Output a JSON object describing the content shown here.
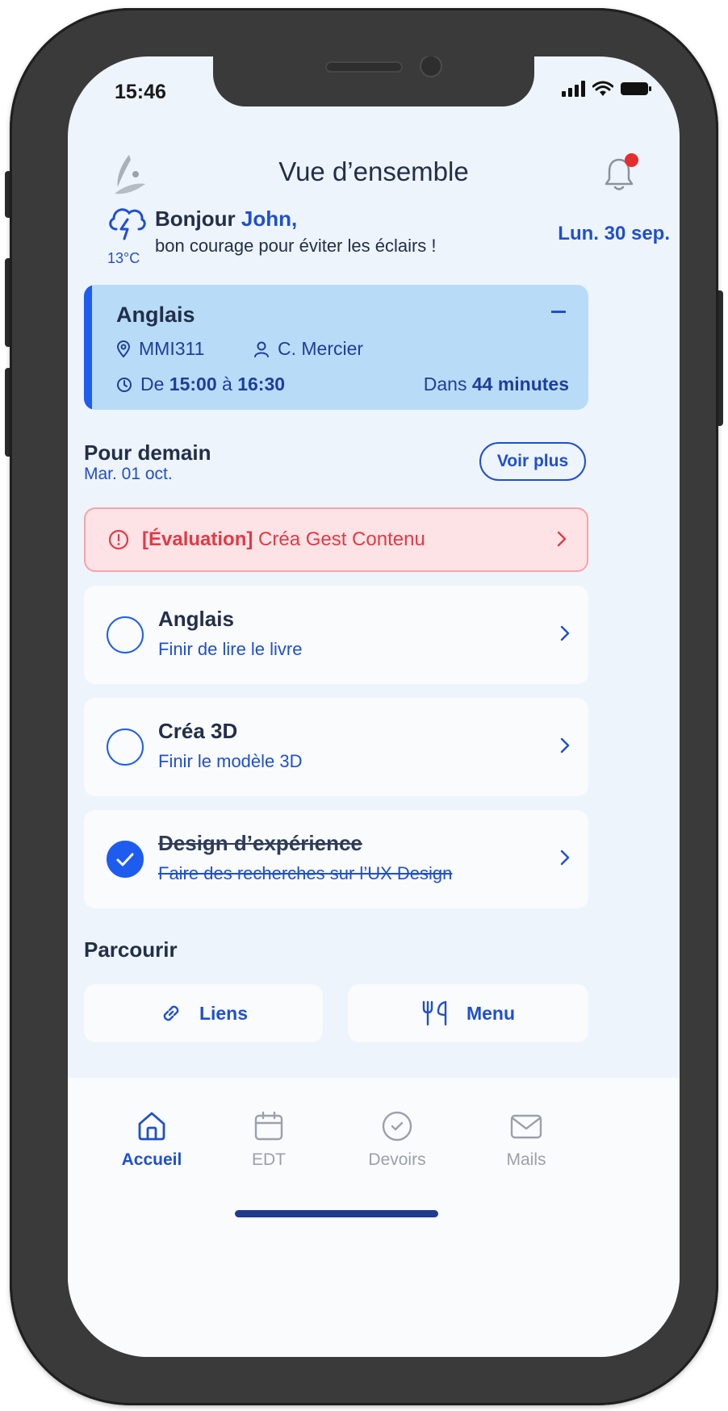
{
  "status_bar": {
    "time": "15:46"
  },
  "header": {
    "title": "Vue d’ensemble"
  },
  "greeting": {
    "hello": "Bonjour",
    "name": "John,",
    "message": "bon courage pour éviter les éclairs !",
    "temperature": "13°C",
    "date": "Lun. 30 sep."
  },
  "current_course": {
    "subject": "Anglais",
    "room": "MMI311",
    "teacher": "C. Mercier",
    "time_prefix": "De",
    "time_start": "15:00",
    "time_sep": "à",
    "time_end": "16:30",
    "countdown_prefix": "Dans",
    "countdown_value": "44 minutes"
  },
  "tomorrow": {
    "title": "Pour demain",
    "date": "Mar. 01 oct.",
    "see_more": "Voir plus",
    "alert": {
      "tag": "[Évaluation]",
      "text": "Créa Gest Contenu"
    },
    "tasks": [
      {
        "subject": "Anglais",
        "description": "Finir de lire le livre",
        "done": false
      },
      {
        "subject": "Créa 3D",
        "description": "Finir le modèle 3D",
        "done": false
      },
      {
        "subject": "Design d’expérience",
        "description": "Faire des recherches sur l’UX Design",
        "done": true
      }
    ]
  },
  "browse": {
    "title": "Parcourir",
    "links_label": "Liens",
    "menu_label": "Menu"
  },
  "bottom_nav": {
    "items": [
      {
        "label": "Accueil",
        "icon": "home-icon",
        "active": true
      },
      {
        "label": "EDT",
        "icon": "calendar-icon",
        "active": false
      },
      {
        "label": "Devoirs",
        "icon": "check-circle-icon",
        "active": false
      },
      {
        "label": "Mails",
        "icon": "mail-icon",
        "active": false
      }
    ]
  },
  "colors": {
    "accent": "#1e4fcf",
    "background": "#eef4fb",
    "course_card": "#b8dcf8",
    "alert": "#e53844",
    "notification_dot": "#e52d2d"
  }
}
